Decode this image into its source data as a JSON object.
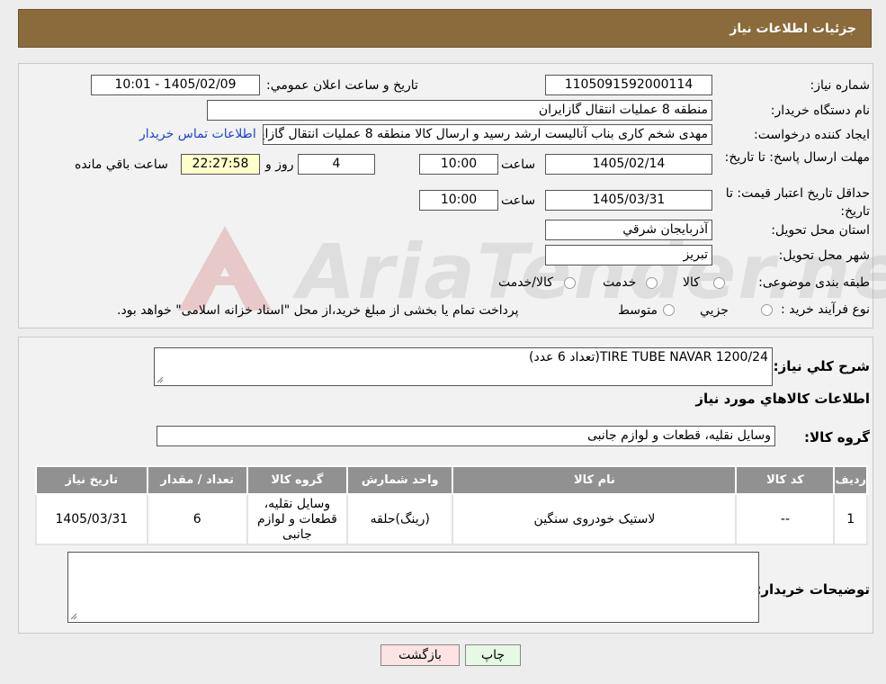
{
  "header": {
    "title": "جزئیات اطلاعات نیاز"
  },
  "fields": {
    "need_number_label": "شماره نیاز:",
    "need_number": "1105091592000114",
    "announce_label": "تاریخ و ساعت اعلان عمومي:",
    "announce_value": "1405/02/09 - 10:01",
    "buyer_org_label": "نام دستگاه خريدار:",
    "buyer_org": "منطقه 8 عمليات انتقال گازايران",
    "requester_label": "ايجاد کننده درخواست:",
    "requester": "مهدی شخم کاری بناب آنالیست ارشد رسید و ارسال کالا منطقه 8 عملیات انتقال گازایران",
    "contact_link": "اطلاعات تماس خريدار",
    "deadline_label": "مهلت ارسال پاسخ: تا تاريخ:",
    "deadline_date": "1405/02/14",
    "time_label": "ساعت",
    "deadline_time": "10:00",
    "days_value": "4",
    "days_label": "روز و",
    "remaining_time": "22:27:58",
    "remaining_label": "ساعت باقي مانده",
    "price_validity_label": "حداقل تاريخ اعتبار قيمت: تا تاريخ:",
    "price_validity_date": "1405/03/31",
    "price_validity_time": "10:00",
    "province_label": "استان محل تحويل:",
    "province": "آذربايجان شرقي",
    "city_label": "شهر محل تحويل:",
    "city": "تبريز",
    "category_label": "طبقه بندی موضوعی:",
    "category_options": [
      "کالا",
      "خدمت",
      "کالا/خدمت"
    ],
    "process_label": "نوع فرآيند خريد :",
    "process_options": [
      "جزيي",
      "متوسط"
    ],
    "process_note": "پرداخت تمام يا بخشی از مبلغ خريد،از محل \"اسناد خزانه اسلامی\" خواهد بود."
  },
  "watermark": {
    "text": "AriaTender.neT"
  },
  "description": {
    "label": "شرح کلي نياز:",
    "value": "TIRE TUBE NAVAR 1200/24(تعداد 6 عدد)"
  },
  "goods": {
    "section_title": "اطلاعات کالاهاي مورد نياز",
    "group_label": "گروه کالا:",
    "group_value": "وسايل نقليه، قطعات و لوازم جانبی"
  },
  "table": {
    "headers": [
      "رديف",
      "کد کالا",
      "نام کالا",
      "واحد شمارش",
      "گروه کالا",
      "تعداد / مقدار",
      "تاريخ نياز"
    ],
    "rows": [
      [
        "1",
        "--",
        "لاستيک خودروی سنگين",
        "(رينگ)حلقه",
        "وسايل نقليه، قطعات و لوازم جانبی",
        "6",
        "1405/03/31"
      ]
    ]
  },
  "buyer_notes": {
    "label": "توضيحات خريدار:",
    "value": ""
  },
  "buttons": {
    "print": "چاپ",
    "back": "بازگشت"
  }
}
